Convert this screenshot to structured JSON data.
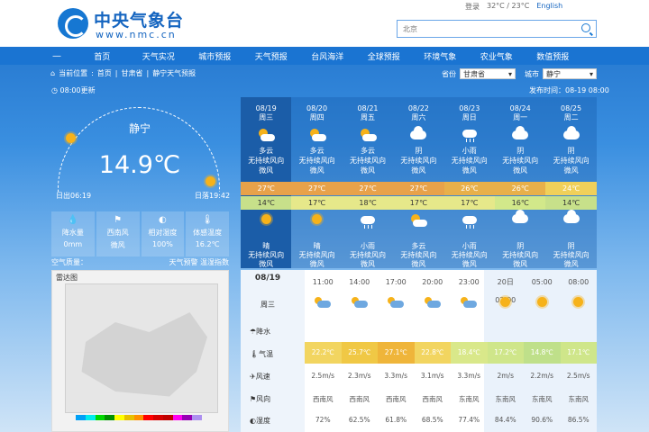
{
  "header": {
    "logo_cn": "中央气象台",
    "logo_en": "www.nmc.cn",
    "top_links": [
      "登录",
      "32°C / 23°C"
    ],
    "lang": "English",
    "search_placeholder": "北京"
  },
  "nav": {
    "menu": "—",
    "items": [
      "首页",
      "天气实况",
      "城市预报",
      "天气预报",
      "台风海洋",
      "全球预报",
      "环境气象",
      "农业气象",
      "数值预报"
    ]
  },
  "breadcrumb": [
    "当前位置",
    "首页",
    "甘肃省",
    "静宁天气预报"
  ],
  "selectors": {
    "province_label": "省份",
    "province": "甘肃省",
    "city_label": "城市",
    "city": "静宁"
  },
  "publish_time": "发布时间：08-19 08:00",
  "update_time": "08:00更新",
  "current": {
    "city": "静宁",
    "temp": "14.9℃",
    "sunrise": "日出06:19",
    "sunset": "日落19:42",
    "quick": [
      {
        "icon": "rain-drop-icon",
        "label": "降水量",
        "value": "0mm"
      },
      {
        "icon": "wind-icon",
        "label": "西南风",
        "value": "微风"
      },
      {
        "icon": "humidity-icon",
        "label": "相对湿度",
        "value": "100%"
      },
      {
        "icon": "thermometer-icon",
        "label": "体感温度",
        "value": "16.2℃"
      }
    ],
    "air_quality": "空气质量：",
    "air_links": [
      "天气预警",
      "温湿指数"
    ]
  },
  "radar": {
    "title": "雷达图",
    "legend_colors": [
      "#01a0f6",
      "#00ecec",
      "#00d800",
      "#019000",
      "#ffff00",
      "#e7c000",
      "#ff9000",
      "#ff0000",
      "#d60000",
      "#c00000",
      "#ff00f0",
      "#9600b4",
      "#ad90f0"
    ]
  },
  "forecast": [
    {
      "date": "08/19",
      "weekday": "周三",
      "day_icon": "partly-cloudy",
      "day_weather": "多云",
      "day_wind": "无持续风向",
      "day_level": "微风",
      "high": "27℃",
      "low": "14℃",
      "night_icon": "sunny",
      "night_weather": "晴",
      "night_wind": "无持续风向",
      "night_level": "微风",
      "hi_color": "#e8a24a",
      "lo_color": "#c7e08a"
    },
    {
      "date": "08/20",
      "weekday": "周四",
      "day_icon": "partly-cloudy",
      "day_weather": "多云",
      "day_wind": "无持续风向",
      "day_level": "微风",
      "high": "27℃",
      "low": "17℃",
      "night_icon": "sunny",
      "night_weather": "晴",
      "night_wind": "无持续风向",
      "night_level": "微风",
      "hi_color": "#e8a24a",
      "lo_color": "#e6e88a"
    },
    {
      "date": "08/21",
      "weekday": "周五",
      "day_icon": "partly-cloudy",
      "day_weather": "多云",
      "day_wind": "无持续风向",
      "day_level": "微风",
      "high": "27℃",
      "low": "18℃",
      "night_icon": "rain",
      "night_weather": "小雨",
      "night_wind": "无持续风向",
      "night_level": "微风",
      "hi_color": "#e8a24a",
      "lo_color": "#e6e88a"
    },
    {
      "date": "08/22",
      "weekday": "周六",
      "day_icon": "cloudy",
      "day_weather": "阴",
      "day_wind": "无持续风向",
      "day_level": "微风",
      "high": "27℃",
      "low": "17℃",
      "night_icon": "partly-cloudy",
      "night_weather": "多云",
      "night_wind": "无持续风向",
      "night_level": "微风",
      "hi_color": "#e8a24a",
      "lo_color": "#e6e88a"
    },
    {
      "date": "08/23",
      "weekday": "周日",
      "day_icon": "rain",
      "day_weather": "小雨",
      "day_wind": "无持续风向",
      "day_level": "微风",
      "high": "26℃",
      "low": "17℃",
      "night_icon": "rain",
      "night_weather": "小雨",
      "night_wind": "无持续风向",
      "night_level": "微风",
      "hi_color": "#e8b04a",
      "lo_color": "#e6e88a"
    },
    {
      "date": "08/24",
      "weekday": "周一",
      "day_icon": "cloudy",
      "day_weather": "阴",
      "day_wind": "无持续风向",
      "day_level": "微风",
      "high": "26℃",
      "low": "16℃",
      "night_icon": "cloudy",
      "night_weather": "阴",
      "night_wind": "无持续风向",
      "night_level": "微风",
      "hi_color": "#e8b04a",
      "lo_color": "#d2e88a"
    },
    {
      "date": "08/25",
      "weekday": "周二",
      "day_icon": "cloudy",
      "day_weather": "阴",
      "day_wind": "无持续风向",
      "day_level": "微风",
      "high": "24℃",
      "low": "14℃",
      "night_icon": "cloudy",
      "night_weather": "阴",
      "night_wind": "无持续风向",
      "night_level": "微风",
      "hi_color": "#f0d05a",
      "lo_color": "#c7e08a"
    }
  ],
  "hourly": {
    "date": "08/19",
    "weekday": "周三",
    "row_labels": [
      "降水",
      "气温",
      "风速",
      "风向",
      "湿度"
    ],
    "times": [
      "11:00",
      "14:00",
      "17:00",
      "20:00",
      "23:00",
      "20日02:00",
      "05:00",
      "08:00"
    ],
    "icons": [
      "partly-cloudy",
      "partly-cloudy",
      "partly-cloudy",
      "partly-cloudy",
      "partly-cloudy",
      "sunny",
      "sunny",
      "sunny"
    ],
    "temps": [
      "22.2℃",
      "25.7℃",
      "27.1℃",
      "22.8℃",
      "18.4℃",
      "17.2℃",
      "14.8℃",
      "17.1℃"
    ],
    "temp_colors": [
      "#f2d560",
      "#f0c845",
      "#efb53a",
      "#f2d560",
      "#d9e88a",
      "#cfe68a",
      "#bfe08a",
      "#cfe68a"
    ],
    "wind_speed": [
      "2.5m/s",
      "2.3m/s",
      "3.3m/s",
      "3.1m/s",
      "3.3m/s",
      "2m/s",
      "2.2m/s",
      "2.5m/s"
    ],
    "wind_dir": [
      "西南风",
      "西南风",
      "西南风",
      "西南风",
      "东南风",
      "东南风",
      "东南风",
      "东南风"
    ],
    "humidity": [
      "72%",
      "62.5%",
      "61.8%",
      "68.5%",
      "77.4%",
      "84.4%",
      "90.6%",
      "86.5%"
    ]
  }
}
